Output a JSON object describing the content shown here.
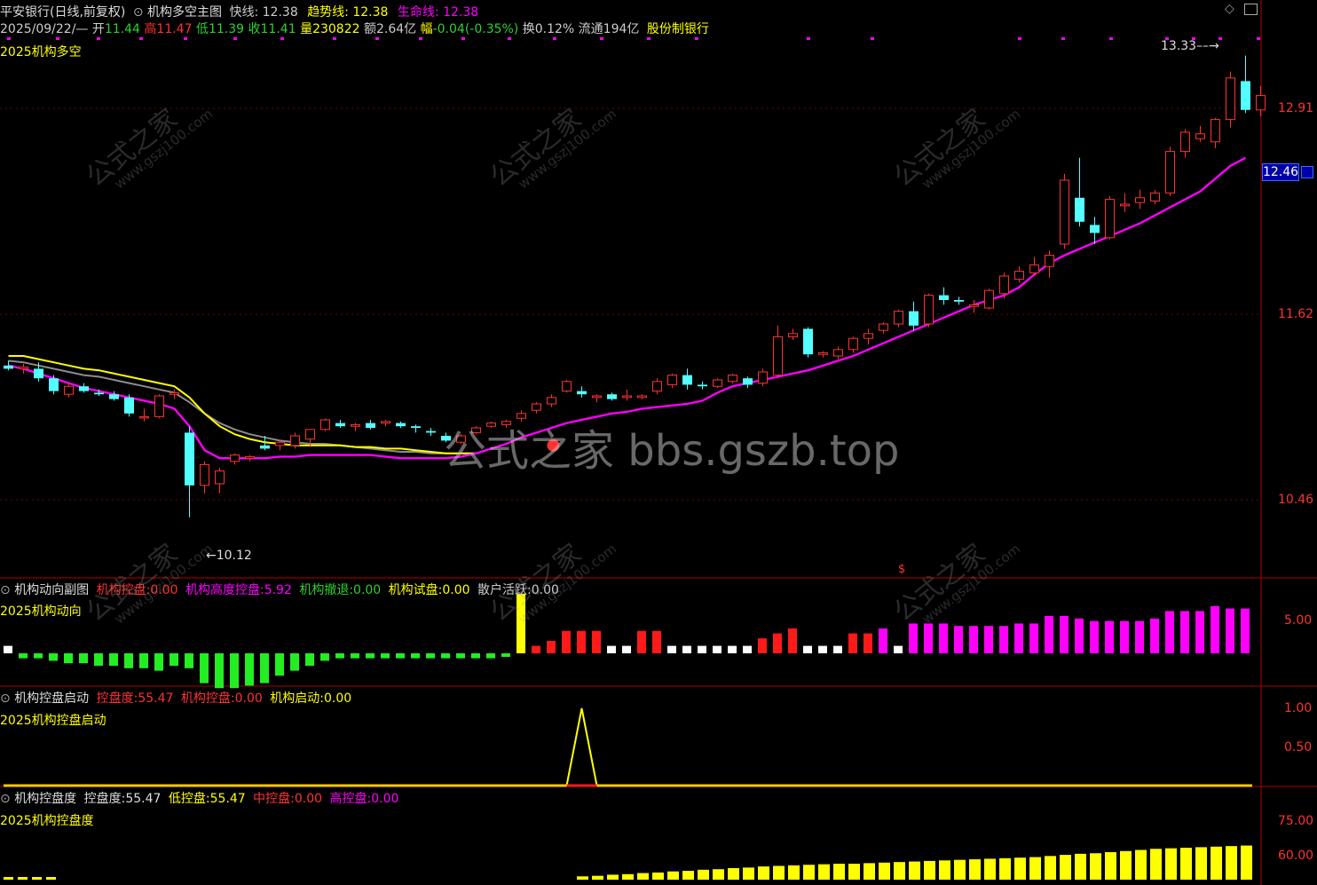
{
  "header": {
    "stock_name": "平安银行(日线,前复权)",
    "indicator_name": "机构多空主图",
    "fast_label": "快线:",
    "fast_value": "12.38",
    "trend_label": "趋势线:",
    "trend_value": "12.38",
    "life_label": "生命线:",
    "life_value": "12.38",
    "date": "2025/09/22/—",
    "open_label": "开",
    "open_value": "11.44",
    "high_label": "高",
    "high_value": "11.47",
    "low_label": "低",
    "low_value": "11.39",
    "close_label": "收",
    "close_value": "11.41",
    "volume_label": "量",
    "volume_value": "230822",
    "amount_label": "额",
    "amount_value": "2.64亿",
    "change_label": "幅",
    "change_value": "-0.04(-0.35%)",
    "turnover_label": "换",
    "turnover_value": "0.12%",
    "float_label": "流通",
    "float_value": "194亿",
    "company_type": "股份制银行",
    "formula_name": "2025机构多空"
  },
  "main_chart": {
    "price_axis": [
      "12.91",
      "11.62",
      "10.46"
    ],
    "current_price": "12.46",
    "high_note": "13.33",
    "low_note": "10.12",
    "signal_marker": "$",
    "colors": {
      "up": "#ff3232",
      "down": "#54ffff",
      "fast": "#ffff00",
      "trend": "#8c8c8c",
      "life": "#ff00ff"
    }
  },
  "watermark": {
    "main": "公式之家 bbs.gszb.top",
    "tile_cn": "公式之家",
    "tile_url": "www.gszj100.com"
  },
  "sub1": {
    "title": "机构动向副图",
    "i1_label": "机构控盘:",
    "i1_value": "0.00",
    "i2_label": "机构高度控盘:",
    "i2_value": "5.92",
    "i3_label": "机构撤退:",
    "i3_value": "0.00",
    "i4_label": "机构试盘:",
    "i4_value": "0.00",
    "i5_label": "散户活跃:",
    "i5_value": "0.00",
    "formula_name": "2025机构动向",
    "axis": [
      "5.00"
    ]
  },
  "sub2": {
    "title": "机构控盘启动",
    "i1_label": "控盘度:",
    "i1_value": "55.47",
    "i2_label": "机构控盘:",
    "i2_value": "0.00",
    "i3_label": "机构启动:",
    "i3_value": "0.00",
    "formula_name": "2025机构控盘启动",
    "axis": [
      "1.00",
      "0.50"
    ]
  },
  "sub3": {
    "title": "机构控盘度",
    "i1_label": "控盘度:",
    "i1_value": "55.47",
    "i2_label": "低控盘:",
    "i2_value": "55.47",
    "i3_label": "中控盘:",
    "i3_value": "0.00",
    "i4_label": "高控盘:",
    "i4_value": "0.00",
    "formula_name": "2025机构控盘度",
    "axis": [
      "75.00",
      "60.00"
    ]
  },
  "chart_data": {
    "type": "candlestick",
    "ylim": [
      10.0,
      13.5
    ],
    "candles": [
      [
        11.3,
        11.33,
        11.27,
        11.28
      ],
      [
        11.28,
        11.31,
        11.25,
        11.29
      ],
      [
        11.28,
        11.32,
        11.2,
        11.22
      ],
      [
        11.22,
        11.24,
        11.12,
        11.14
      ],
      [
        11.12,
        11.19,
        11.1,
        11.17
      ],
      [
        11.17,
        11.19,
        11.13,
        11.14
      ],
      [
        11.13,
        11.15,
        11.11,
        11.12
      ],
      [
        11.12,
        11.14,
        11.08,
        11.09
      ],
      [
        11.1,
        11.12,
        10.98,
        11.0
      ],
      [
        10.98,
        11.03,
        10.95,
        10.98
      ],
      [
        10.98,
        11.12,
        10.97,
        11.11
      ],
      [
        11.12,
        11.15,
        11.09,
        11.13
      ],
      [
        10.88,
        10.92,
        10.35,
        10.55
      ],
      [
        10.55,
        10.7,
        10.5,
        10.68
      ],
      [
        10.56,
        10.66,
        10.5,
        10.64
      ],
      [
        10.7,
        10.75,
        10.68,
        10.74
      ],
      [
        10.72,
        10.74,
        10.7,
        10.73
      ],
      [
        10.8,
        10.86,
        10.77,
        10.78
      ],
      [
        10.8,
        10.83,
        10.77,
        10.82
      ],
      [
        10.8,
        10.88,
        10.78,
        10.86
      ],
      [
        10.84,
        10.9,
        10.79,
        10.9
      ],
      [
        10.9,
        10.97,
        10.89,
        10.96
      ],
      [
        10.94,
        10.96,
        10.91,
        10.92
      ],
      [
        10.92,
        10.94,
        10.89,
        10.93
      ],
      [
        10.94,
        10.96,
        10.9,
        10.91
      ],
      [
        10.94,
        10.96,
        10.92,
        10.95
      ],
      [
        10.94,
        10.95,
        10.91,
        10.92
      ],
      [
        10.92,
        10.93,
        10.88,
        10.91
      ],
      [
        10.89,
        10.91,
        10.86,
        10.88
      ],
      [
        10.86,
        10.88,
        10.82,
        10.83
      ],
      [
        10.82,
        10.87,
        10.81,
        10.86
      ],
      [
        10.88,
        10.92,
        10.87,
        10.91
      ],
      [
        10.92,
        10.95,
        10.91,
        10.94
      ],
      [
        10.93,
        10.96,
        10.91,
        10.95
      ],
      [
        10.97,
        11.02,
        10.95,
        11.0
      ],
      [
        11.02,
        11.07,
        11.0,
        11.06
      ],
      [
        11.06,
        11.12,
        11.04,
        11.1
      ],
      [
        11.14,
        11.21,
        11.13,
        11.2
      ],
      [
        11.14,
        11.17,
        11.1,
        11.12
      ],
      [
        11.1,
        11.12,
        11.07,
        11.11
      ],
      [
        11.12,
        11.13,
        11.08,
        11.09
      ],
      [
        11.1,
        11.15,
        11.08,
        11.11
      ],
      [
        11.1,
        11.12,
        11.09,
        11.11
      ],
      [
        11.14,
        11.22,
        11.12,
        11.2
      ],
      [
        11.18,
        11.25,
        11.16,
        11.24
      ],
      [
        11.24,
        11.28,
        11.15,
        11.18
      ],
      [
        11.18,
        11.2,
        11.15,
        11.17
      ],
      [
        11.17,
        11.22,
        11.16,
        11.21
      ],
      [
        11.2,
        11.25,
        11.19,
        11.24
      ],
      [
        11.22,
        11.23,
        11.16,
        11.18
      ],
      [
        11.19,
        11.28,
        11.17,
        11.26
      ],
      [
        11.24,
        11.55,
        11.22,
        11.48
      ],
      [
        11.48,
        11.53,
        11.46,
        11.5
      ],
      [
        11.53,
        11.54,
        11.35,
        11.37
      ],
      [
        11.37,
        11.39,
        11.35,
        11.38
      ],
      [
        11.36,
        11.42,
        11.34,
        11.4
      ],
      [
        11.4,
        11.48,
        11.38,
        11.47
      ],
      [
        11.47,
        11.53,
        11.43,
        11.5
      ],
      [
        11.52,
        11.57,
        11.5,
        11.56
      ],
      [
        11.56,
        11.65,
        11.54,
        11.64
      ],
      [
        11.64,
        11.7,
        11.52,
        11.55
      ],
      [
        11.56,
        11.75,
        11.54,
        11.74
      ],
      [
        11.74,
        11.79,
        11.68,
        11.71
      ],
      [
        11.71,
        11.73,
        11.68,
        11.7
      ],
      [
        11.67,
        11.71,
        11.63,
        11.68
      ],
      [
        11.66,
        11.78,
        11.65,
        11.77
      ],
      [
        11.75,
        11.88,
        11.72,
        11.86
      ],
      [
        11.84,
        11.92,
        11.82,
        11.89
      ],
      [
        11.88,
        11.98,
        11.86,
        11.93
      ],
      [
        11.92,
        12.02,
        11.85,
        11.99
      ],
      [
        12.06,
        12.5,
        12.03,
        12.46
      ],
      [
        12.35,
        12.6,
        12.17,
        12.2
      ],
      [
        12.18,
        12.23,
        12.06,
        12.13
      ],
      [
        12.1,
        12.36,
        12.09,
        12.34
      ],
      [
        12.3,
        12.38,
        12.26,
        12.31
      ],
      [
        12.32,
        12.4,
        12.28,
        12.35
      ],
      [
        12.33,
        12.4,
        12.31,
        12.38
      ],
      [
        12.38,
        12.67,
        12.36,
        12.64
      ],
      [
        12.64,
        12.78,
        12.6,
        12.76
      ],
      [
        12.72,
        12.8,
        12.7,
        12.75
      ],
      [
        12.7,
        12.85,
        12.66,
        12.84
      ],
      [
        12.84,
        13.14,
        12.79,
        13.1
      ],
      [
        13.08,
        13.24,
        12.88,
        12.9
      ],
      [
        12.9,
        13.05,
        12.86,
        12.99
      ]
    ],
    "fast": [
      11.36,
      11.36,
      11.34,
      11.32,
      11.3,
      11.28,
      11.27,
      11.25,
      11.23,
      11.21,
      11.19,
      11.17,
      11.1,
      11.0,
      10.92,
      10.87,
      10.84,
      10.82,
      10.81,
      10.8,
      10.8,
      10.8,
      10.8,
      10.79,
      10.79,
      10.78,
      10.78,
      10.77,
      10.76,
      10.75,
      10.75,
      10.75
    ],
    "trend": [
      11.33,
      11.32,
      11.3,
      11.28,
      11.26,
      11.24,
      11.23,
      11.21,
      11.19,
      11.17,
      11.15,
      11.13,
      11.07,
      11.0,
      10.94,
      10.9,
      10.87,
      10.85,
      10.83,
      10.82,
      10.81,
      10.81,
      10.8,
      10.79,
      10.78,
      10.77,
      10.76,
      10.76,
      10.75,
      10.75,
      10.75,
      10.75
    ],
    "life": [
      11.3,
      11.28,
      11.25,
      11.22,
      11.19,
      11.16,
      11.14,
      11.12,
      11.1,
      11.08,
      11.06,
      11.03,
      10.92,
      10.77,
      10.72,
      10.72,
      10.72,
      10.72,
      10.73,
      10.73,
      10.74,
      10.74,
      10.74,
      10.74,
      10.74,
      10.73,
      10.72,
      10.72,
      10.72,
      10.72,
      10.73,
      10.75,
      10.78,
      10.81,
      10.85,
      10.88,
      10.91,
      10.94,
      10.96,
      10.98,
      11.0,
      11.01,
      11.03,
      11.04,
      11.05,
      11.06,
      11.08,
      11.13,
      11.17,
      11.19,
      11.21,
      11.23,
      11.25,
      11.27,
      11.3,
      11.33,
      11.36,
      11.4,
      11.44,
      11.48,
      11.52,
      11.56,
      11.6,
      11.64,
      11.68,
      11.71,
      11.74,
      11.79,
      11.87,
      11.94,
      11.99,
      12.03,
      12.07,
      12.11,
      12.15,
      12.19,
      12.24,
      12.29,
      12.34,
      12.39,
      12.47,
      12.55,
      12.6
    ],
    "sub1_bars": [
      [
        "w",
        0.3
      ],
      [
        "g",
        0.2
      ],
      [
        "g",
        0.2
      ],
      [
        "g",
        0.3
      ],
      [
        "g",
        0.4
      ],
      [
        "g",
        0.4
      ],
      [
        "g",
        0.5
      ],
      [
        "g",
        0.5
      ],
      [
        "g",
        0.6
      ],
      [
        "g",
        0.6
      ],
      [
        "g",
        0.7
      ],
      [
        "g",
        0.5
      ],
      [
        "g",
        0.6
      ],
      [
        "g",
        1.2
      ],
      [
        "g",
        1.4
      ],
      [
        "g",
        1.4
      ],
      [
        "g",
        1.3
      ],
      [
        "g",
        1.2
      ],
      [
        "g",
        0.9
      ],
      [
        "g",
        0.7
      ],
      [
        "g",
        0.5
      ],
      [
        "g",
        0.3
      ],
      [
        "g",
        0.2
      ],
      [
        "g",
        0.2
      ],
      [
        "g",
        0.2
      ],
      [
        "g",
        0.2
      ],
      [
        "g",
        0.2
      ],
      [
        "g",
        0.2
      ],
      [
        "g",
        0.2
      ],
      [
        "g",
        0.2
      ],
      [
        "g",
        0.2
      ],
      [
        "g",
        0.2
      ],
      [
        "g",
        0.2
      ],
      [
        "g",
        0.1
      ],
      [
        "y",
        2.4
      ],
      [
        "r",
        0.3
      ],
      [
        "r",
        0.5
      ],
      [
        "r",
        0.9
      ],
      [
        "r",
        0.9
      ],
      [
        "r",
        0.9
      ],
      [
        "w",
        0.3
      ],
      [
        "w",
        0.3
      ],
      [
        "r",
        0.9
      ],
      [
        "r",
        0.9
      ],
      [
        "w",
        0.3
      ],
      [
        "w",
        0.3
      ],
      [
        "w",
        0.3
      ],
      [
        "w",
        0.3
      ],
      [
        "w",
        0.3
      ],
      [
        "w",
        0.3
      ],
      [
        "r",
        0.6
      ],
      [
        "r",
        0.8
      ],
      [
        "r",
        1.0
      ],
      [
        "w",
        0.3
      ],
      [
        "w",
        0.3
      ],
      [
        "w",
        0.3
      ],
      [
        "r",
        0.8
      ],
      [
        "r",
        0.8
      ],
      [
        "m",
        1.0
      ],
      [
        "w",
        0.3
      ],
      [
        "m",
        1.2
      ],
      [
        "m",
        1.2
      ],
      [
        "m",
        1.2
      ],
      [
        "m",
        1.1
      ],
      [
        "m",
        1.1
      ],
      [
        "m",
        1.1
      ],
      [
        "m",
        1.1
      ],
      [
        "m",
        1.2
      ],
      [
        "m",
        1.2
      ],
      [
        "m",
        1.5
      ],
      [
        "m",
        1.5
      ],
      [
        "m",
        1.4
      ],
      [
        "m",
        1.3
      ],
      [
        "m",
        1.3
      ],
      [
        "m",
        1.3
      ],
      [
        "m",
        1.3
      ],
      [
        "m",
        1.4
      ],
      [
        "m",
        1.7
      ],
      [
        "m",
        1.7
      ],
      [
        "m",
        1.7
      ],
      [
        "m",
        1.9
      ],
      [
        "m",
        1.8
      ],
      [
        "m",
        1.8
      ]
    ],
    "sub2_peak": {
      "index": 38,
      "value": 1.0
    },
    "sub3_bars": [
      0,
      0,
      0,
      0,
      0,
      0,
      0,
      0,
      0,
      0,
      0,
      0,
      0,
      0,
      0,
      0,
      0,
      0,
      0,
      0,
      0,
      0,
      0,
      0,
      0,
      0,
      0,
      0,
      0,
      0,
      0,
      0,
      0,
      0,
      0,
      0,
      0,
      0,
      55.0,
      55.1,
      55.3,
      55.4,
      55.6,
      55.7,
      55.9,
      56.0,
      56.2,
      56.3,
      56.5,
      56.6,
      56.8,
      56.9,
      57.0,
      57.1,
      57.2,
      57.3,
      57.3,
      57.4,
      57.5,
      57.6,
      57.7,
      57.8,
      57.9,
      58.0,
      58.1,
      58.2,
      58.3,
      58.4,
      58.5,
      58.7,
      58.9,
      59.1,
      59.2,
      59.4,
      59.6,
      59.8,
      60.0,
      60.1,
      60.2,
      60.3,
      60.4,
      60.5,
      60.6
    ]
  }
}
